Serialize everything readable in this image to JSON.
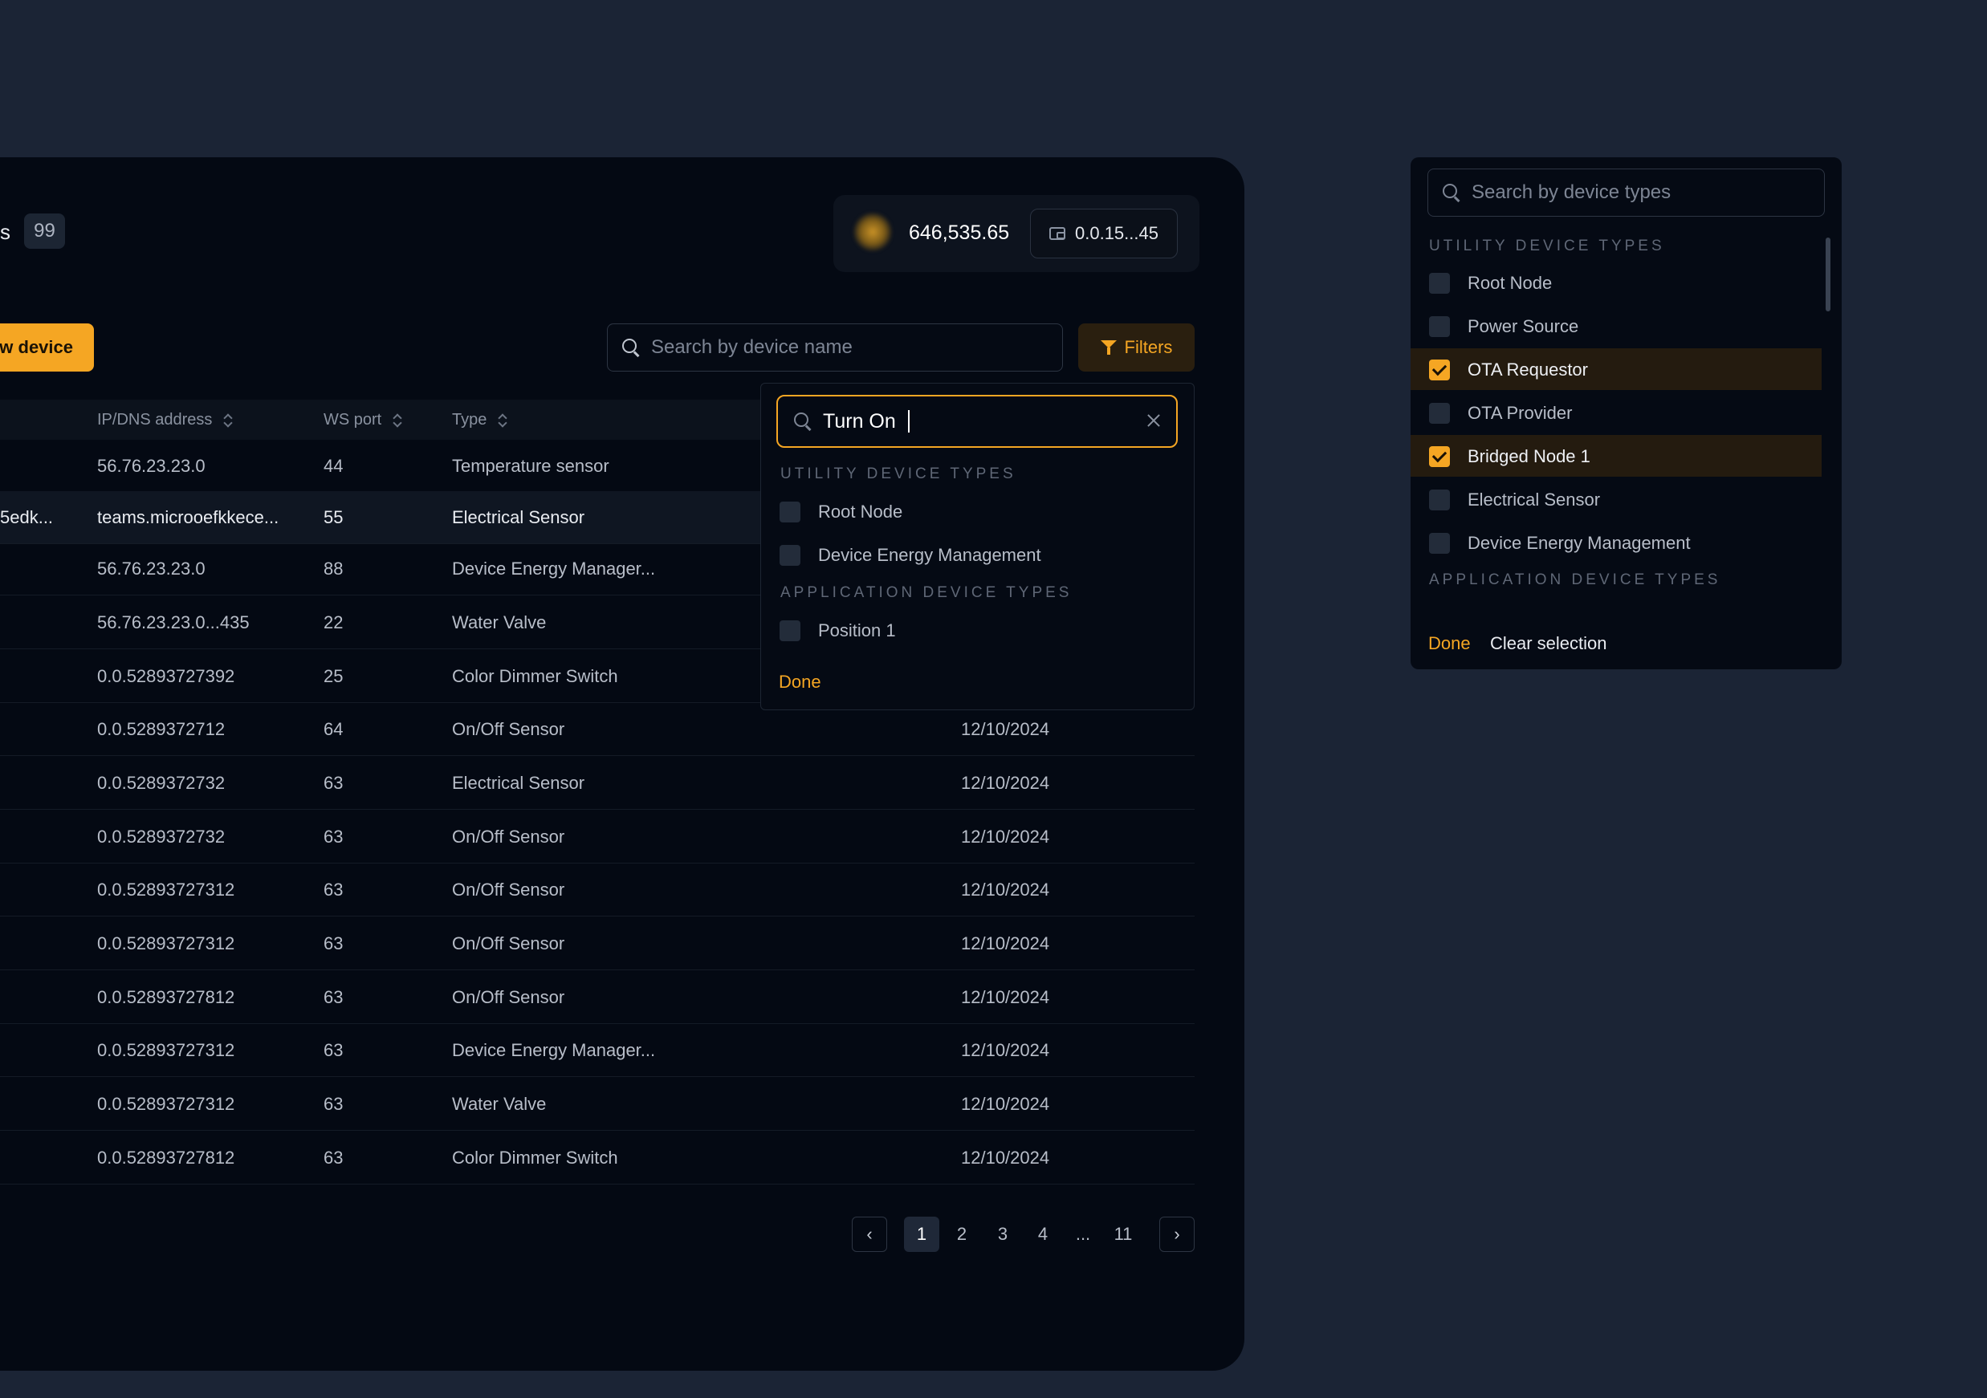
{
  "header": {
    "title_fragment": "s",
    "device_count": "99",
    "balance": "646,535.65",
    "wallet_address": "0.0.15...45"
  },
  "toolbar": {
    "add_device_label": "ew device",
    "search_placeholder": "Search by device name",
    "filters_label": "Filters"
  },
  "table": {
    "columns": [
      "IP/DNS address",
      "WS port",
      "Type"
    ],
    "rows": [
      {
        "name": "",
        "ip": "56.76.23.23.0",
        "port": "44",
        "type": "Temperature sensor",
        "date": ""
      },
      {
        "name": "5edk...",
        "ip": "teams.microoefkkece...",
        "port": "55",
        "type": "Electrical Sensor",
        "date": ""
      },
      {
        "name": "",
        "ip": "56.76.23.23.0",
        "port": "88",
        "type": "Device Energy Manager...",
        "date": ""
      },
      {
        "name": "",
        "ip": "56.76.23.23.0...435",
        "port": "22",
        "type": "Water Valve",
        "date": ""
      },
      {
        "name": "",
        "ip": "0.0.52893727392",
        "port": "25",
        "type": "Color Dimmer Switch",
        "date": ""
      },
      {
        "name": "",
        "ip": "0.0.5289372712",
        "port": "64",
        "type": "On/Off Sensor",
        "date": "12/10/2024"
      },
      {
        "name": "",
        "ip": "0.0.5289372732",
        "port": "63",
        "type": "Electrical Sensor",
        "date": "12/10/2024"
      },
      {
        "name": "",
        "ip": "0.0.5289372732",
        "port": "63",
        "type": "On/Off Sensor",
        "date": "12/10/2024"
      },
      {
        "name": "",
        "ip": "0.0.52893727312",
        "port": "63",
        "type": "On/Off Sensor",
        "date": "12/10/2024"
      },
      {
        "name": "",
        "ip": "0.0.52893727312",
        "port": "63",
        "type": "On/Off Sensor",
        "date": "12/10/2024"
      },
      {
        "name": "",
        "ip": "0.0.52893727812",
        "port": "63",
        "type": "On/Off Sensor",
        "date": "12/10/2024"
      },
      {
        "name": "",
        "ip": "0.0.52893727312",
        "port": "63",
        "type": "Device Energy Manager...",
        "date": "12/10/2024"
      },
      {
        "name": "",
        "ip": "0.0.52893727312",
        "port": "63",
        "type": "Water Valve",
        "date": "12/10/2024"
      },
      {
        "name": "",
        "ip": "0.0.52893727812",
        "port": "63",
        "type": "Color Dimmer Switch",
        "date": "12/10/2024"
      }
    ]
  },
  "pagination": {
    "pages": [
      "1",
      "2",
      "3",
      "4",
      "...",
      "11"
    ],
    "current": "1"
  },
  "filter_dropdown": {
    "search_value": "Turn On",
    "utility_label": "UTILITY DEVICE TYPES",
    "utility_items": [
      "Root Node",
      "Device Energy Management"
    ],
    "application_label": "APPLICATION DEVICE TYPES",
    "application_items": [
      "Position 1"
    ],
    "done_label": "Done"
  },
  "type_panel": {
    "search_placeholder": "Search by device types",
    "utility_label": "UTILITY DEVICE TYPES",
    "items": [
      {
        "label": "Root Node",
        "checked": false
      },
      {
        "label": "Power Source",
        "checked": false
      },
      {
        "label": "OTA Requestor",
        "checked": true
      },
      {
        "label": "OTA Provider",
        "checked": false
      },
      {
        "label": "Bridged Node 1",
        "checked": true
      },
      {
        "label": "Electrical Sensor",
        "checked": false
      },
      {
        "label": "Device Energy Management",
        "checked": false
      }
    ],
    "application_label": "APPLICATION DEVICE TYPES",
    "done_label": "Done",
    "clear_label": "Clear selection"
  },
  "colors": {
    "accent": "#f5a623",
    "background": "#1b2435",
    "panel": "#040913"
  }
}
